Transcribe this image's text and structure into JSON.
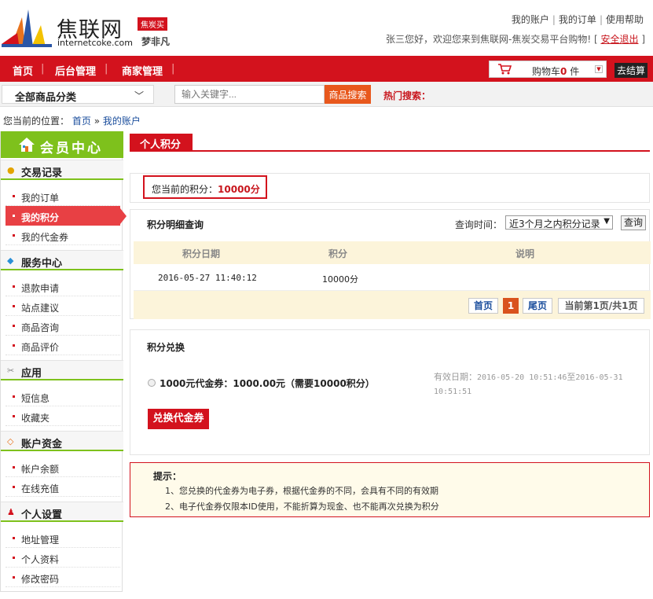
{
  "brand": {
    "name_cn": "焦联网",
    "domain": "internetcoke.com",
    "tag": "焦炭买",
    "slogan": "梦非凡"
  },
  "top_links": [
    "我的账户",
    "我的订单",
    "使用帮助"
  ],
  "welcome": {
    "text": "张三您好，欢迎您来到焦联网-焦炭交易平台购物!  [",
    "logout": "安全退出",
    "close": "]"
  },
  "nav": {
    "items": [
      "首页",
      "后台管理",
      "商家管理"
    ],
    "cart_label": "购物车",
    "cart_count": "0",
    "cart_unit": "件",
    "checkout": "去结算"
  },
  "search": {
    "category": "全部商品分类",
    "placeholder": "输入关键字...",
    "button": "商品搜索",
    "hot": "热门搜索："
  },
  "breadcrumb": {
    "prefix": "您当前的位置：",
    "home": "首页",
    "sep": "»",
    "current": "我的账户"
  },
  "sidebar": {
    "title": "会员中心",
    "sections": [
      {
        "label": "交易记录",
        "items": [
          "我的订单",
          "我的积分",
          "我的代金券"
        ]
      },
      {
        "label": "服务中心",
        "items": [
          "退款申请",
          "站点建议",
          "商品咨询",
          "商品评价"
        ]
      },
      {
        "label": "应用",
        "items": [
          "短信息",
          "收藏夹"
        ]
      },
      {
        "label": "账户资金",
        "items": [
          "帐户余额",
          "在线充值"
        ]
      },
      {
        "label": "个人设置",
        "items": [
          "地址管理",
          "个人资料",
          "修改密码"
        ]
      }
    ],
    "active_item": "我的积分"
  },
  "main": {
    "tab": "个人积分",
    "current_label": "您当前的积分：",
    "current_value": "10000分",
    "detail": {
      "title": "积分明细查询",
      "query_label": "查询时间：",
      "query_option": "近3个月之内积分记录",
      "query_button": "查询",
      "columns": [
        "积分日期",
        "积分",
        "说明"
      ],
      "rows": [
        {
          "date": "2016-05-27 11:40:12",
          "points": "10000分",
          "note": ""
        }
      ],
      "pager": {
        "first": "首页",
        "current": "1",
        "last": "尾页",
        "info": "当前第1页/共1页"
      }
    },
    "exchange": {
      "title": "积分兑换",
      "option": "1000元代金券：1000.00元（需要10000积分）",
      "valid_label": "有效日期：",
      "valid_from": "2016-05-20 10:51:46",
      "valid_to_sep": "至",
      "valid_to_date": "2016-05-31",
      "valid_to_time": "10:51:51",
      "button": "兑换代金券"
    },
    "tips": {
      "title": "提示：",
      "lines": [
        "1、您兑换的代金券为电子券，根据代金券的不同，会具有不同的有效期",
        "2、电子代金券仅限本ID使用，不能折算为现金、也不能再次兑换为积分"
      ]
    }
  },
  "colors": {
    "brand_red": "#d3121d",
    "sidebar_green": "#7ec11c",
    "active_item": "#e84044",
    "search_button": "#e8581d",
    "table_header": "#fcf4da"
  }
}
